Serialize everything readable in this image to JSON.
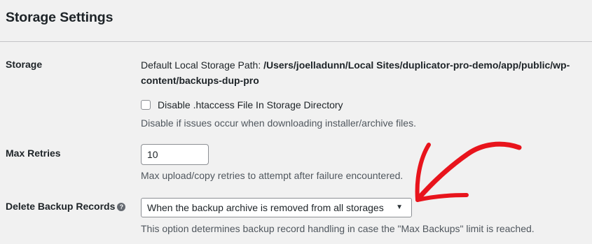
{
  "heading": "Storage Settings",
  "storage": {
    "label": "Storage",
    "path_prefix": "Default Local Storage Path: ",
    "path_value": "/Users/joelladunn/Local Sites/duplicator-pro-demo/app/public/wp-content/backups-dup-pro",
    "checkbox_label": "Disable .htaccess File In Storage Directory",
    "checkbox_checked": false,
    "checkbox_desc": "Disable if issues occur when downloading installer/archive files."
  },
  "max_retries": {
    "label": "Max Retries",
    "value": "10",
    "desc": "Max upload/copy retries to attempt after failure encountered."
  },
  "delete_records": {
    "label": "Delete Backup Records",
    "help_glyph": "?",
    "selected": "When the backup archive is removed from all storages",
    "desc": "This option determines backup record handling in case the \"Max Backups\" limit is reached."
  },
  "annotation": {
    "arrow_color": "#e8141c"
  }
}
